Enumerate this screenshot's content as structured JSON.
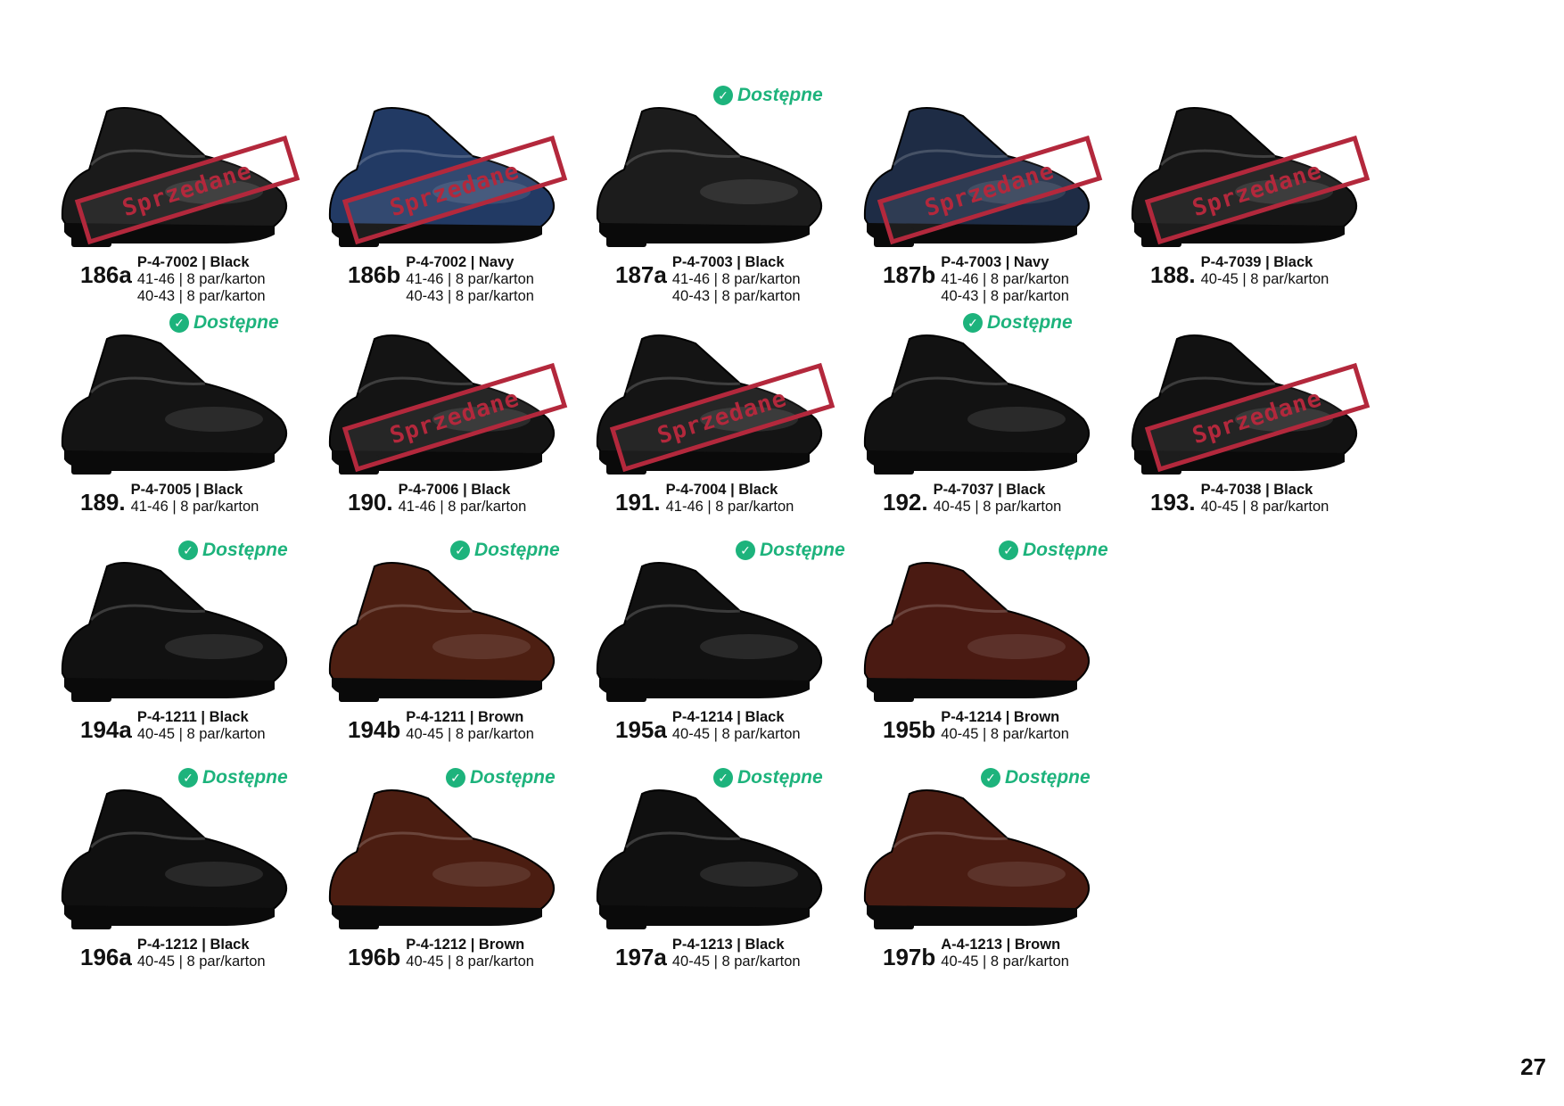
{
  "page_number": "27",
  "stamp_text": "Sprzedane",
  "available_text": "Dostępne",
  "items": [
    {
      "num": "186a",
      "code": "P-4-7002 | Black",
      "lines": [
        "41-46 | 8 par/karton",
        "40-43 | 8 par/karton"
      ],
      "status": "sold",
      "color": "#1a1a1a"
    },
    {
      "num": "186b",
      "code": "P-4-7002 | Navy",
      "lines": [
        "41-46 | 8 par/karton",
        "40-43 | 8 par/karton"
      ],
      "status": "sold",
      "color": "#223a64"
    },
    {
      "num": "187a",
      "code": "P-4-7003 | Black",
      "lines": [
        "41-46 | 8 par/karton",
        "40-43 | 8 par/karton"
      ],
      "status": "available",
      "color": "#1c1c1c"
    },
    {
      "num": "187b",
      "code": "P-4-7003 | Navy",
      "lines": [
        "41-46 | 8 par/karton",
        "40-43 | 8 par/karton"
      ],
      "status": "sold",
      "color": "#1e2c45"
    },
    {
      "num": "188.",
      "code": "P-4-7039 | Black",
      "lines": [
        "40-45 | 8 par/karton"
      ],
      "status": "sold",
      "color": "#161616"
    },
    {
      "num": "189.",
      "code": "P-4-7005 | Black",
      "lines": [
        "41-46 | 8 par/karton"
      ],
      "status": "available",
      "color": "#141414"
    },
    {
      "num": "190.",
      "code": "P-4-7006 | Black",
      "lines": [
        "41-46 | 8 par/karton"
      ],
      "status": "sold",
      "color": "#141414"
    },
    {
      "num": "191.",
      "code": "P-4-7004 | Black",
      "lines": [
        "41-46 | 8 par/karton"
      ],
      "status": "sold",
      "color": "#141414"
    },
    {
      "num": "192.",
      "code": "P-4-7037 | Black",
      "lines": [
        "40-45 | 8 par/karton"
      ],
      "status": "available",
      "color": "#121212"
    },
    {
      "num": "193.",
      "code": "P-4-7038 | Black",
      "lines": [
        "40-45 | 8 par/karton"
      ],
      "status": "sold",
      "color": "#121212"
    },
    {
      "num": "194a",
      "code": "P-4-1211 | Black",
      "lines": [
        "40-45 | 8 par/karton"
      ],
      "status": "available",
      "color": "#111111"
    },
    {
      "num": "194b",
      "code": "P-4-1211 | Brown",
      "lines": [
        "40-45 | 8 par/karton"
      ],
      "status": "available",
      "color": "#4d1f12"
    },
    {
      "num": "195a",
      "code": "P-4-1214 | Black",
      "lines": [
        "40-45 | 8 par/karton"
      ],
      "status": "available",
      "color": "#111111"
    },
    {
      "num": "195b",
      "code": "P-4-1214 | Brown",
      "lines": [
        "40-45 | 8 par/karton"
      ],
      "status": "available",
      "color": "#4a1a12"
    },
    {
      "num": "196a",
      "code": "P-4-1212 | Black",
      "lines": [
        "40-45 | 8 par/karton"
      ],
      "status": "available",
      "color": "#101010"
    },
    {
      "num": "196b",
      "code": "P-4-1212 | Brown",
      "lines": [
        "40-45 | 8 par/karton"
      ],
      "status": "available",
      "color": "#4b1d11"
    },
    {
      "num": "197a",
      "code": "P-4-1213 | Black",
      "lines": [
        "40-45 | 8 par/karton"
      ],
      "status": "available",
      "color": "#101010"
    },
    {
      "num": "197b",
      "code": "A-4-1213 | Brown",
      "lines": [
        "40-45 | 8 par/karton"
      ],
      "status": "available",
      "color": "#4a1c12"
    }
  ]
}
